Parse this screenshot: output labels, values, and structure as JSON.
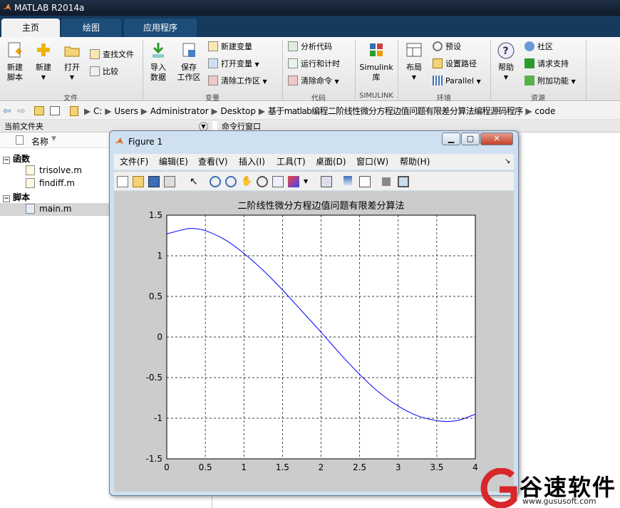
{
  "app": {
    "title": "MATLAB R2014a"
  },
  "tabs": [
    {
      "label": "主页"
    },
    {
      "label": "绘图"
    },
    {
      "label": "应用程序"
    }
  ],
  "ribbon": {
    "new_script": "新建\n脚本",
    "new": "新建",
    "open": "打开",
    "find_files": "查找文件",
    "compare": "比较",
    "import_data": "导入\n数据",
    "save_workspace": "保存\n工作区",
    "new_variable": "新建变量",
    "open_variable": "打开变量",
    "clear_workspace": "清除工作区",
    "analyze_code": "分析代码",
    "run_and_time": "运行和计时",
    "clear_commands": "清除命令",
    "simulink_library": "Simulink\n库",
    "layout": "布局",
    "preferences": "预设",
    "set_path": "设置路径",
    "parallel": "Parallel",
    "help": "帮助",
    "community": "社区",
    "request_support": "请求支持",
    "addons": "附加功能",
    "groups": {
      "file": "文件",
      "variable": "变量",
      "code": "代码",
      "simulink": "SIMULINK",
      "environment": "环境",
      "resources": "资源"
    }
  },
  "path": {
    "segments": [
      "C:",
      "Users",
      "Administrator",
      "Desktop",
      "基于matlab编程二阶线性微分方程边值问题有限差分算法编程源码程序",
      "code"
    ]
  },
  "current_folder": {
    "title": "当前文件夹",
    "column_name": "名称",
    "groups": [
      {
        "label": "函数",
        "files": [
          "trisolve.m",
          "findiff.m"
        ]
      },
      {
        "label": "脚本",
        "files": [
          "main.m"
        ]
      }
    ]
  },
  "command_window": {
    "title": "命令行窗口"
  },
  "figure": {
    "window_title": "Figure 1",
    "menus": [
      "文件(F)",
      "编辑(E)",
      "查看(V)",
      "插入(I)",
      "工具(T)",
      "桌面(D)",
      "窗口(W)",
      "帮助(H)"
    ]
  },
  "chart_data": {
    "type": "line",
    "title": "二阶线性微分方程边值问题有限差分算法",
    "xlim": [
      0,
      4
    ],
    "ylim": [
      -1.5,
      1.5
    ],
    "xticks": [
      "0",
      "0.5",
      "1",
      "1.5",
      "2",
      "2.5",
      "3",
      "3.5",
      "4"
    ],
    "yticks": [
      "1.5",
      "1",
      "0.5",
      "0",
      "-0.5",
      "-1",
      "-1.5"
    ],
    "grid": true,
    "series": [
      {
        "color": "#0000ff",
        "x": [
          0,
          0.25,
          0.35,
          0.5,
          0.75,
          1.0,
          1.25,
          1.5,
          1.75,
          2.0,
          2.25,
          2.5,
          2.75,
          3.0,
          3.25,
          3.5,
          3.65,
          3.8,
          4.0
        ],
        "y": [
          1.27,
          1.33,
          1.335,
          1.31,
          1.2,
          1.03,
          0.82,
          0.58,
          0.32,
          0.06,
          -0.21,
          -0.46,
          -0.68,
          -0.85,
          -0.97,
          -1.03,
          -1.04,
          -1.02,
          -0.95
        ]
      }
    ]
  },
  "watermark": {
    "brand": "谷速软件",
    "url": "www.gususoft.com"
  }
}
